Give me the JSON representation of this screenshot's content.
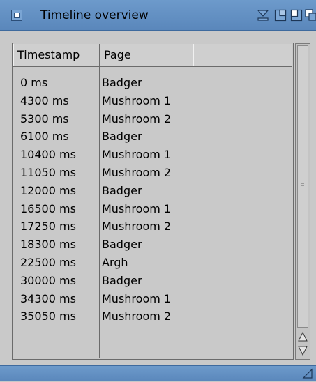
{
  "window": {
    "title": "Timeline overview"
  },
  "table": {
    "columns": [
      "Timestamp",
      "Page",
      ""
    ],
    "rows": [
      {
        "timestamp": "0 ms",
        "page": "Badger"
      },
      {
        "timestamp": "4300 ms",
        "page": "Mushroom 1"
      },
      {
        "timestamp": "5300 ms",
        "page": "Mushroom 2"
      },
      {
        "timestamp": "6100 ms",
        "page": "Badger"
      },
      {
        "timestamp": "10400 ms",
        "page": "Mushroom 1"
      },
      {
        "timestamp": "11050 ms",
        "page": "Mushroom 2"
      },
      {
        "timestamp": "12000 ms",
        "page": "Badger"
      },
      {
        "timestamp": "16500 ms",
        "page": "Mushroom 1"
      },
      {
        "timestamp": "17250 ms",
        "page": "Mushroom 2"
      },
      {
        "timestamp": "18300 ms",
        "page": "Badger"
      },
      {
        "timestamp": "22500 ms",
        "page": "Argh"
      },
      {
        "timestamp": "30000 ms",
        "page": "Badger"
      },
      {
        "timestamp": "34300 ms",
        "page": "Mushroom 1"
      },
      {
        "timestamp": "35050 ms",
        "page": "Mushroom 2"
      }
    ]
  },
  "icons": {
    "close": "close-icon",
    "iconify": "iconify-icon",
    "zoom": "zoom-icon",
    "depth_front": "depth-front-icon",
    "depth_back": "depth-back-icon",
    "scroll_up": "arrow-up-icon",
    "scroll_down": "arrow-down-icon",
    "resize": "resize-grip-icon"
  },
  "colors": {
    "titlebar": "#6d9acb",
    "background": "#c9c9c9",
    "border": "#6b6b6b"
  }
}
